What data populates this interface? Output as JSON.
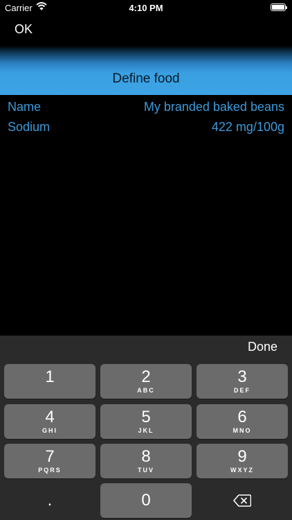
{
  "status_bar": {
    "carrier": "Carrier",
    "time": "4:10 PM"
  },
  "nav": {
    "ok_label": "OK"
  },
  "title": "Define food",
  "fields": [
    {
      "label": "Name",
      "value": "My branded baked beans"
    },
    {
      "label": "Sodium",
      "value": "422 mg/100g"
    }
  ],
  "keyboard": {
    "done_label": "Done",
    "keys": [
      {
        "digit": "1",
        "letters": ""
      },
      {
        "digit": "2",
        "letters": "ABC"
      },
      {
        "digit": "3",
        "letters": "DEF"
      },
      {
        "digit": "4",
        "letters": "GHI"
      },
      {
        "digit": "5",
        "letters": "JKL"
      },
      {
        "digit": "6",
        "letters": "MNO"
      },
      {
        "digit": "7",
        "letters": "PQRS"
      },
      {
        "digit": "8",
        "letters": "TUV"
      },
      {
        "digit": "9",
        "letters": "WXYZ"
      },
      {
        "digit": ".",
        "letters": ""
      },
      {
        "digit": "0",
        "letters": ""
      }
    ]
  },
  "colors": {
    "accent": "#3ca3e5",
    "field_text": "#3d9ad9",
    "key_bg": "#6b6b6b",
    "keyboard_bg": "#2b2b2b"
  }
}
